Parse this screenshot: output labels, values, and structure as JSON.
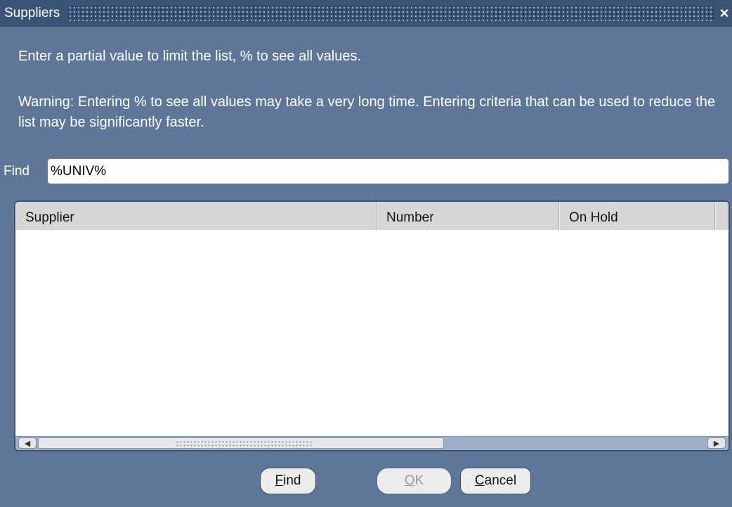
{
  "window": {
    "title": "Suppliers",
    "close_glyph": "×"
  },
  "messages": {
    "hint": "Enter a partial value to limit the list, % to see all values.",
    "warning": "Warning: Entering % to see all values may take a very long time. Entering criteria that can be used to reduce the list may be significantly faster."
  },
  "find": {
    "label": "Find",
    "value": "%UNIV%"
  },
  "grid": {
    "columns": [
      "Supplier",
      "Number",
      "On Hold"
    ],
    "rows": []
  },
  "buttons": {
    "find": {
      "mnemonic": "F",
      "rest": "ind"
    },
    "ok": {
      "mnemonic": "O",
      "rest": "K",
      "enabled": false
    },
    "cancel": {
      "mnemonic": "C",
      "rest": "ancel"
    }
  }
}
